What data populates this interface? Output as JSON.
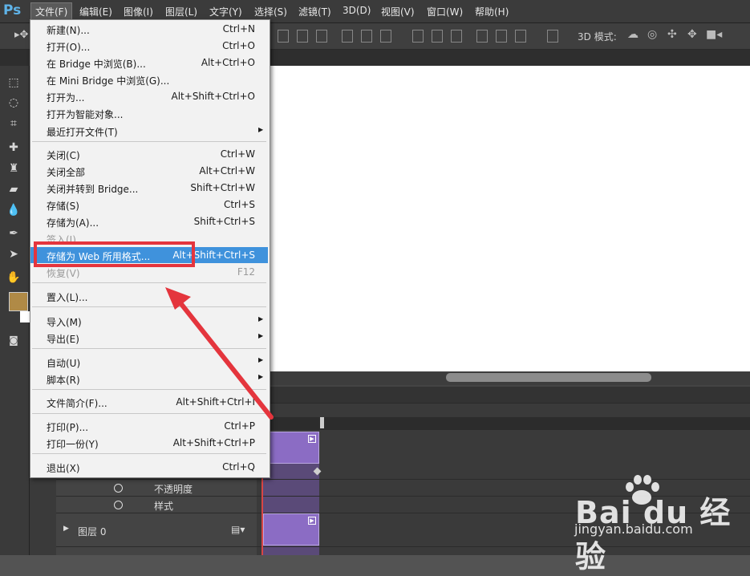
{
  "app": {
    "logo": "Ps"
  },
  "menubar": {
    "items": [
      "文件(F)",
      "编辑(E)",
      "图像(I)",
      "图层(L)",
      "文字(Y)",
      "选择(S)",
      "滤镜(T)",
      "3D(D)",
      "视图(V)",
      "窗口(W)",
      "帮助(H)"
    ]
  },
  "options_bar": {
    "mode_3d_label": "3D 模式:"
  },
  "file_menu": {
    "items": [
      {
        "label": "新建(N)...",
        "shortcut": "Ctrl+N"
      },
      {
        "label": "打开(O)...",
        "shortcut": "Ctrl+O"
      },
      {
        "label": "在 Bridge 中浏览(B)...",
        "shortcut": "Alt+Ctrl+O"
      },
      {
        "label": "在 Mini Bridge 中浏览(G)...",
        "shortcut": ""
      },
      {
        "label": "打开为...",
        "shortcut": "Alt+Shift+Ctrl+O"
      },
      {
        "label": "打开为智能对象...",
        "shortcut": ""
      },
      {
        "label": "最近打开文件(T)",
        "shortcut": ""
      },
      {
        "label": "关闭(C)",
        "shortcut": "Ctrl+W"
      },
      {
        "label": "关闭全部",
        "shortcut": "Alt+Ctrl+W"
      },
      {
        "label": "关闭并转到 Bridge...",
        "shortcut": "Shift+Ctrl+W"
      },
      {
        "label": "存储(S)",
        "shortcut": "Ctrl+S"
      },
      {
        "label": "存储为(A)...",
        "shortcut": "Shift+Ctrl+S"
      },
      {
        "label": "签入(I)...",
        "shortcut": ""
      },
      {
        "label": "存储为 Web 所用格式...",
        "shortcut": "Alt+Shift+Ctrl+S"
      },
      {
        "label": "恢复(V)",
        "shortcut": "F12"
      },
      {
        "label": "置入(L)...",
        "shortcut": ""
      },
      {
        "label": "导入(M)",
        "shortcut": ""
      },
      {
        "label": "导出(E)",
        "shortcut": ""
      },
      {
        "label": "自动(U)",
        "shortcut": ""
      },
      {
        "label": "脚本(R)",
        "shortcut": ""
      },
      {
        "label": "文件简介(F)...",
        "shortcut": "Alt+Shift+Ctrl+I"
      },
      {
        "label": "打印(P)...",
        "shortcut": "Ctrl+P"
      },
      {
        "label": "打印一份(Y)",
        "shortcut": "Alt+Shift+Ctrl+P"
      },
      {
        "label": "退出(X)",
        "shortcut": "Ctrl+Q"
      }
    ],
    "highlighted": "存储为 Web 所用格式..."
  },
  "timeline": {
    "rows": [
      "不透明度",
      "样式"
    ],
    "layer_label": "图层 0"
  },
  "watermark": {
    "brand": "Bai du 经验",
    "url": "jingyan.baidu.com"
  },
  "colors": {
    "foreground": "#b08a46",
    "highlight": "#3f92dc",
    "annotation": "#e4353d",
    "clip": "#8b6cc4"
  }
}
